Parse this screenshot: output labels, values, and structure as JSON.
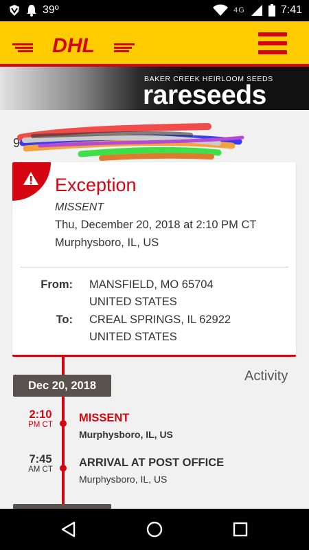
{
  "status_bar": {
    "signal_text": "39º",
    "network": "4G",
    "time": "7:41"
  },
  "header": {
    "logo_text": "DHL",
    "menu_icon": "hamburger-menu-icon"
  },
  "banner": {
    "subtitle": "BAKER CREEK HEIRLOOM SEEDS",
    "brand": "rareseeds"
  },
  "tracking": {
    "number_prefix": "9"
  },
  "status_card": {
    "title": "Exception",
    "subtitle": "MISSENT",
    "datetime": "Thu, December 20, 2018 at 2:10 PM CT",
    "location": "Murphysboro, IL, US",
    "from_label": "From:",
    "from_line1": "MANSFIELD, MO 65704",
    "from_line2": "UNITED STATES",
    "to_label": "To:",
    "to_line1": "CREAL SPRINGS, IL 62922",
    "to_line2": "UNITED STATES",
    "alert_icon": "warning-icon"
  },
  "activity": {
    "title": "Activity",
    "date": "Dec 20, 2018",
    "events": [
      {
        "time": "2:10",
        "ampm": "PM CT",
        "title": "MISSENT",
        "location": "Murphysboro, IL, US",
        "highlight": true
      },
      {
        "time": "7:45",
        "ampm": "AM CT",
        "title": "ARRIVAL AT POST OFFICE",
        "location": "Murphysboro, IL, US",
        "highlight": false
      }
    ]
  },
  "colors": {
    "dhl_yellow": "#ffcc00",
    "dhl_red": "#d40511",
    "chip_gray": "#5a524e"
  },
  "navbar": {
    "back_icon": "back-triangle-icon",
    "home_icon": "home-circle-icon",
    "recents_icon": "recents-square-icon"
  }
}
